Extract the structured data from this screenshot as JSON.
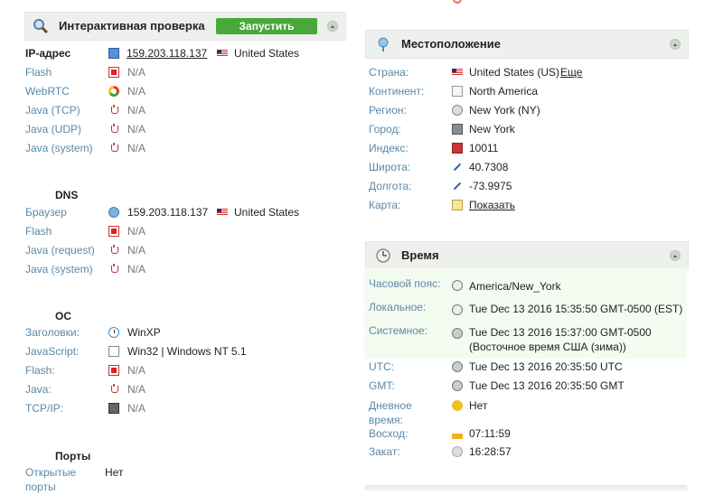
{
  "left": {
    "check": {
      "title": "Интерактивная проверка",
      "run_button": "Запустить"
    },
    "ip": {
      "label": "IP-адрес",
      "value": "159.203.118.137",
      "country": "United States",
      "rows": [
        {
          "label": "Flash",
          "value": "N/A",
          "icon": "flash-icon"
        },
        {
          "label": "WebRTC",
          "value": "N/A",
          "icon": "webrtc-icon"
        },
        {
          "label": "Java (TCP)",
          "value": "N/A",
          "icon": "java-icon"
        },
        {
          "label": "Java (UDP)",
          "value": "N/A",
          "icon": "java-icon"
        },
        {
          "label": "Java (system)",
          "value": "N/A",
          "icon": "java-icon"
        }
      ]
    },
    "dns": {
      "title": "DNS",
      "browser": {
        "label": "Браузер",
        "value": "159.203.118.137",
        "country": "United States"
      },
      "rows": [
        {
          "label": "Flash",
          "value": "N/A"
        },
        {
          "label": "Java (request)",
          "value": "N/A"
        },
        {
          "label": "Java (system)",
          "value": "N/A"
        }
      ]
    },
    "os": {
      "title": "ОС",
      "rows": [
        {
          "label": "Заголовки:",
          "value": "WinXP"
        },
        {
          "label": "JavaScript:",
          "value": "Win32 | Windows NT 5.1"
        },
        {
          "label": "Flash:",
          "value": "N/A"
        },
        {
          "label": "Java:",
          "value": "N/A"
        },
        {
          "label": "TCP/IP:",
          "value": "N/A"
        }
      ]
    },
    "ports": {
      "title": "Порты",
      "label_line1": "Открытые",
      "label_line2": "порты",
      "value": "Нет"
    }
  },
  "location": {
    "title": "Местоположение",
    "rows": [
      {
        "label": "Страна:",
        "value": "United States (US)",
        "link": "Еще"
      },
      {
        "label": "Континент:",
        "value": "North America"
      },
      {
        "label": "Регион:",
        "value": "New York (NY)"
      },
      {
        "label": "Город:",
        "value": "New York"
      },
      {
        "label": "Индекс:",
        "value": "10011"
      },
      {
        "label": "Широта:",
        "value": "40.7308"
      },
      {
        "label": "Долгота:",
        "value": "-73.9975"
      },
      {
        "label": "Карта:",
        "link": "Показать"
      }
    ]
  },
  "time": {
    "title": "Время",
    "rows": [
      {
        "label": "Часовой пояс:",
        "value": "America/New_York"
      },
      {
        "label": "Локальное:",
        "value": "Tue Dec 13 2016 15:35:50 GMT-0500 (EST)"
      },
      {
        "label": "Системное:",
        "value": "Tue Dec 13 2016 15:37:00 GMT-0500",
        "value2": "(Восточное время США (зима))"
      },
      {
        "label": "UTC:",
        "value": "Tue Dec 13 2016 20:35:50 UTC"
      },
      {
        "label": "GMT:",
        "value": "Tue Dec 13 2016 20:35:50 GMT"
      },
      {
        "label": "Дневное",
        "label2": "время:",
        "value": "Нет"
      },
      {
        "label": "Восход:",
        "value": "07:11:59"
      },
      {
        "label": "Закат:",
        "value": "16:28:57"
      }
    ]
  },
  "colors": {
    "accent_green": "#49a83a",
    "label_blue": "#5b88a8",
    "panel_bg": "#eef0ee"
  }
}
